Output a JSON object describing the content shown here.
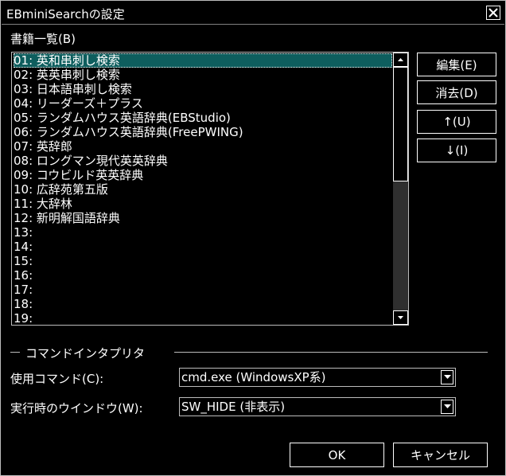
{
  "window": {
    "title": "EBminiSearchの設定"
  },
  "books": {
    "label": "書籍一覧(B)",
    "items": [
      "01: 英和串刺し検索",
      "02: 英英串刺し検索",
      "03: 日本語串刺し検索",
      "04: リーダーズ＋プラス",
      "05: ランダムハウス英語辞典(EBStudio)",
      "06: ランダムハウス英語辞典(FreePWING)",
      "07: 英辞郎",
      "08: ロングマン現代英英辞典",
      "09: コウビルド英英辞典",
      "10: 広辞苑第五版",
      "11: 大辞林",
      "12: 新明解国語辞典",
      "13:",
      "14:",
      "15:",
      "16:",
      "17:",
      "18:",
      "19:"
    ],
    "selected_index": 0
  },
  "buttons": {
    "edit": "編集(E)",
    "delete": "消去(D)",
    "up": "↑(U)",
    "down": "↓(I)",
    "ok": "OK",
    "cancel": "キャンセル"
  },
  "interpreter": {
    "group_label": "コマンドインタプリタ",
    "command_label": "使用コマンド(C):",
    "command_value": "cmd.exe (WindowsXP系)",
    "window_label": "実行時のウインドウ(W):",
    "window_value": "SW_HIDE (非表示)"
  },
  "colors": {
    "selection": "#0e5e5e",
    "background": "#000000",
    "border": "#bcbcbc"
  },
  "icons": {
    "close": "close-icon",
    "scroll_up": "arrow-up-icon",
    "scroll_down": "arrow-down-icon",
    "dropdown": "chevron-down-icon"
  }
}
